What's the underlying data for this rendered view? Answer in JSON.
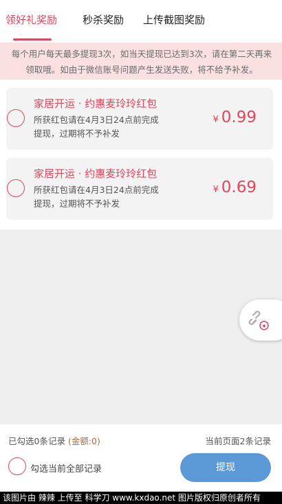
{
  "tabs": [
    {
      "label": "领好礼奖励",
      "active": true
    },
    {
      "label": "秒杀奖励",
      "active": false
    },
    {
      "label": "上传截图奖励",
      "active": false
    }
  ],
  "notice": {
    "line1": "每个用户每天最多提现3次，如当天提现已达到3次，请在第二天再来",
    "line2": "领取哦。如由于微信账号问题产生发送失败，将不给予补发。"
  },
  "records": [
    {
      "title": "家居开运 · 约惠麦玲玲红包",
      "desc_line1": "所获红包请在4月3日24点前完成",
      "desc_line2": "提现，过期将不予补发",
      "currency": "¥",
      "amount": "0.99"
    },
    {
      "title": "家居开运 · 约惠麦玲玲红包",
      "desc_line1": "所获红包请在4月3日24点前完成",
      "desc_line2": "提现，过期将不予补发",
      "currency": "¥",
      "amount": "0.69"
    }
  ],
  "footer": {
    "selected_text": "已勾选0条记录 ",
    "amount_text": "(金额:0)",
    "page_text": "当前页面2条记录",
    "select_all_label": "勾选当前全部记录",
    "withdraw_label": "提现"
  },
  "floating_button": {
    "icon": "link-share-icon"
  },
  "watermark": "该图片由 辣辣 上传至 科学刀 www.kxdao.net 图片版权归原创者所有",
  "colors": {
    "accent": "#e0465c",
    "notice_bg": "#fbe0e2",
    "button_blue": "#5b99d6",
    "amount_brown": "#b8663a"
  }
}
